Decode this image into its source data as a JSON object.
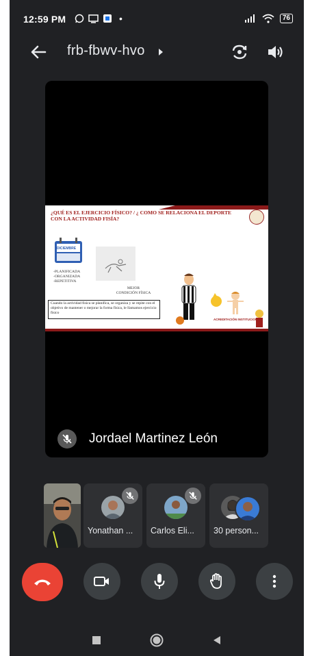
{
  "status_bar": {
    "time": "12:59 PM",
    "battery": "76",
    "icons": [
      "whatsapp-icon",
      "cast-icon",
      "app-icon",
      "signal-icon",
      "wifi-icon",
      "battery-icon"
    ]
  },
  "header": {
    "meeting_code": "frb-fbwv-hvo"
  },
  "main_tile": {
    "presenter_name": "Jordael Martinez León",
    "slide": {
      "title": "¿QUÉ ES  EL EJERCICIO FÍSICO? / ¿ COMO SE RELACIONA EL DEPORTE CON LA ACTIVIDAD FISÍA?",
      "calendar_label": "DICIEMBRE",
      "bullets": [
        "-PLANIFICADA",
        "-ORGANIZADA",
        "-REPETITIVA"
      ],
      "image_caption": [
        "MEJOR",
        "CONDICIÓN FÍSICA"
      ],
      "definition": "Cuando la actividad física se planifica, se organiza y se repite con el objetivo de mantener o mejorar la forma física, le llamamos ejercicio físico",
      "badge": "ACREDITACIÓN INSTITUCIONAL"
    }
  },
  "participants": [
    {
      "name": "Yonathan ...",
      "muted": true
    },
    {
      "name": "Carlos Eli...",
      "muted": true
    },
    {
      "name": "30 person...",
      "muted": false
    }
  ],
  "colors": {
    "background": "#202124",
    "tile": "#2f3033",
    "control": "#3c4043",
    "end_call": "#ea4335",
    "slide_accent": "#a0201d"
  }
}
